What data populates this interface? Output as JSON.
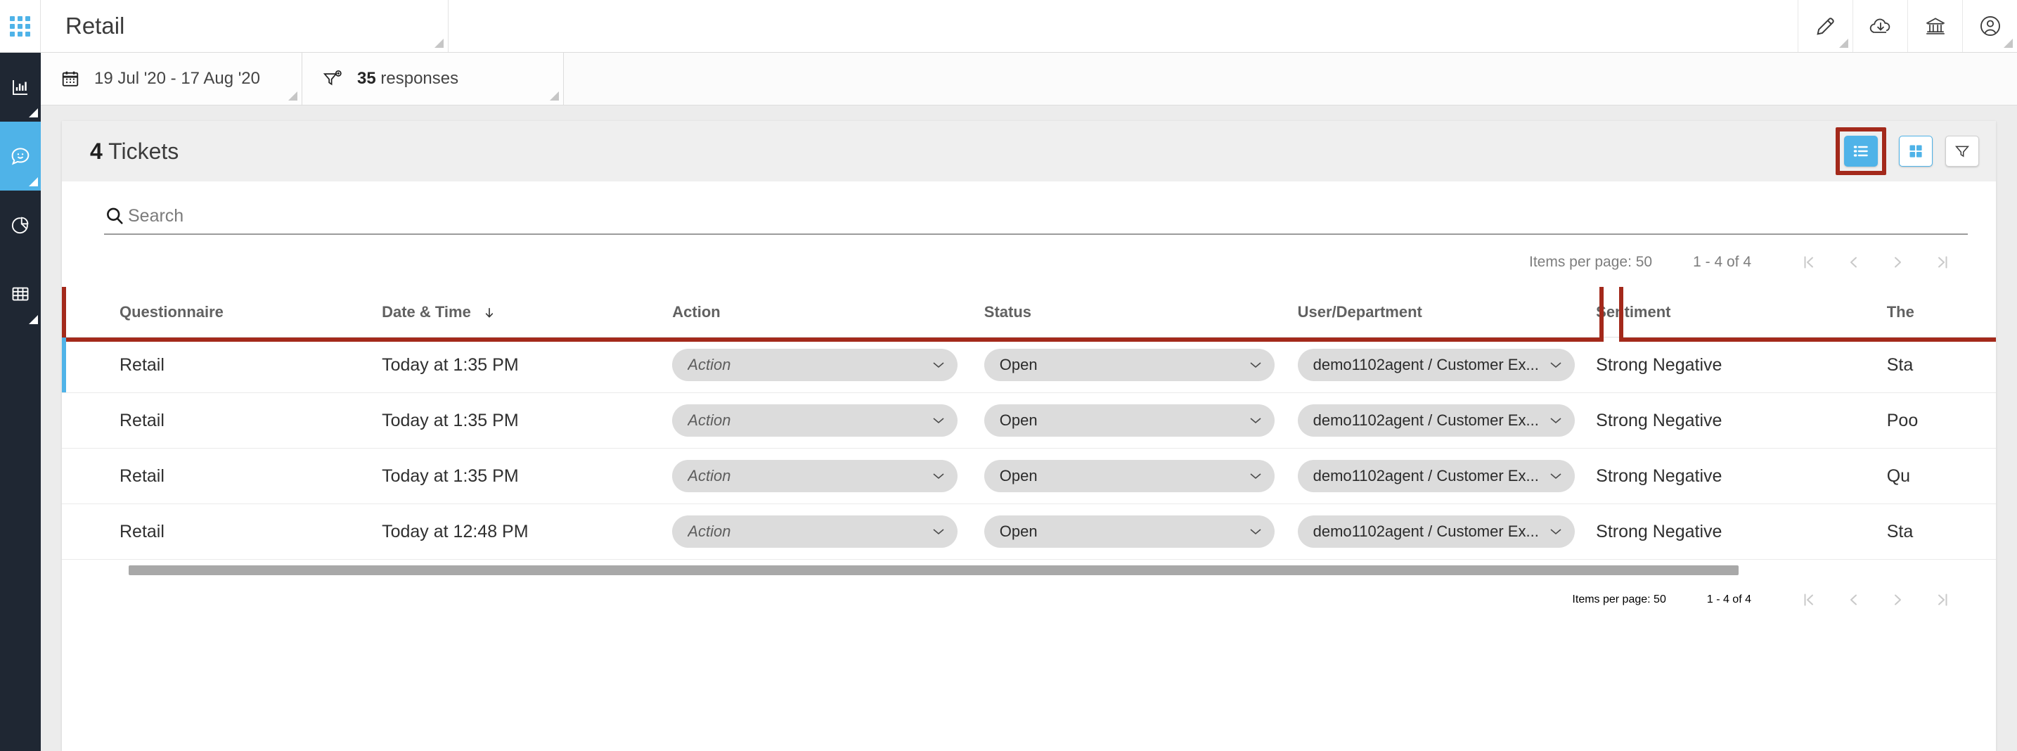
{
  "topbar": {
    "waffle_icon": "apps-grid-icon",
    "title": "Retail",
    "actions": [
      {
        "name": "edit-pencil-icon",
        "label": "Edit"
      },
      {
        "name": "cloud-download-icon",
        "label": "Download"
      },
      {
        "name": "bank-icon",
        "label": "Organization"
      },
      {
        "name": "user-account-icon",
        "label": "Account"
      }
    ]
  },
  "sidebar": {
    "items": [
      {
        "id": "dashboard",
        "icon": "bar-chart-icon",
        "active": false
      },
      {
        "id": "feedback",
        "icon": "chat-smiley-icon",
        "active": true
      },
      {
        "id": "analytics",
        "icon": "pie-chart-icon",
        "active": false
      },
      {
        "id": "data-table",
        "icon": "table-grid-icon",
        "active": false
      }
    ]
  },
  "filters": {
    "date_range": {
      "icon": "calendar-icon",
      "value": "19 Jul '20 - 17 Aug '20"
    },
    "responses": {
      "icon": "filter-add-icon",
      "count": "35",
      "label": "responses"
    }
  },
  "panel": {
    "count": "4",
    "title_suffix": "Tickets",
    "view_list_icon": "list-view-icon",
    "view_grid_icon": "grid-view-icon",
    "filter_icon": "funnel-icon",
    "highlight_color": "#a3291b",
    "accent_color": "#4fb3e8"
  },
  "search": {
    "icon": "search-icon",
    "placeholder": "Search",
    "value": ""
  },
  "paginator": {
    "items_per_page_label": "Items per page: 50",
    "range_label": "1 - 4 of 4",
    "first_icon": "first-page-icon",
    "prev_icon": "previous-page-icon",
    "next_icon": "next-page-icon",
    "last_icon": "last-page-icon"
  },
  "table": {
    "columns": [
      {
        "key": "questionnaire",
        "label": "Questionnaire",
        "sorted": false
      },
      {
        "key": "datetime",
        "label": "Date & Time",
        "sorted": true,
        "sort_icon": "sort-descending-arrow-icon"
      },
      {
        "key": "action",
        "label": "Action",
        "sorted": false
      },
      {
        "key": "status",
        "label": "Status",
        "sorted": false
      },
      {
        "key": "user_department",
        "label": "User/Department",
        "sorted": false
      },
      {
        "key": "sentiment",
        "label": "Sentiment",
        "sorted": false
      },
      {
        "key": "theme",
        "label": "The",
        "sorted": false
      }
    ],
    "rows": [
      {
        "questionnaire": "Retail",
        "datetime": "Today at 1:35 PM",
        "action": "Action",
        "action_is_placeholder": true,
        "status": "Open",
        "user_department": "demo1102agent / Customer Ex...",
        "sentiment": "Strong Negative",
        "theme": "Sta",
        "selected": true
      },
      {
        "questionnaire": "Retail",
        "datetime": "Today at 1:35 PM",
        "action": "Action",
        "action_is_placeholder": true,
        "status": "Open",
        "user_department": "demo1102agent / Customer Ex...",
        "sentiment": "Strong Negative",
        "theme": "Poo",
        "selected": false
      },
      {
        "questionnaire": "Retail",
        "datetime": "Today at 1:35 PM",
        "action": "Action",
        "action_is_placeholder": true,
        "status": "Open",
        "user_department": "demo1102agent / Customer Ex...",
        "sentiment": "Strong Negative",
        "theme": "Qu",
        "selected": false
      },
      {
        "questionnaire": "Retail",
        "datetime": "Today at 12:48 PM",
        "action": "Action",
        "action_is_placeholder": true,
        "status": "Open",
        "user_department": "demo1102agent / Customer Ex...",
        "sentiment": "Strong Negative",
        "theme": "Sta",
        "selected": false
      }
    ]
  },
  "footer_paginator": {
    "items_per_page_label": "Items per page: 50",
    "range_label": "1 - 4 of 4"
  }
}
